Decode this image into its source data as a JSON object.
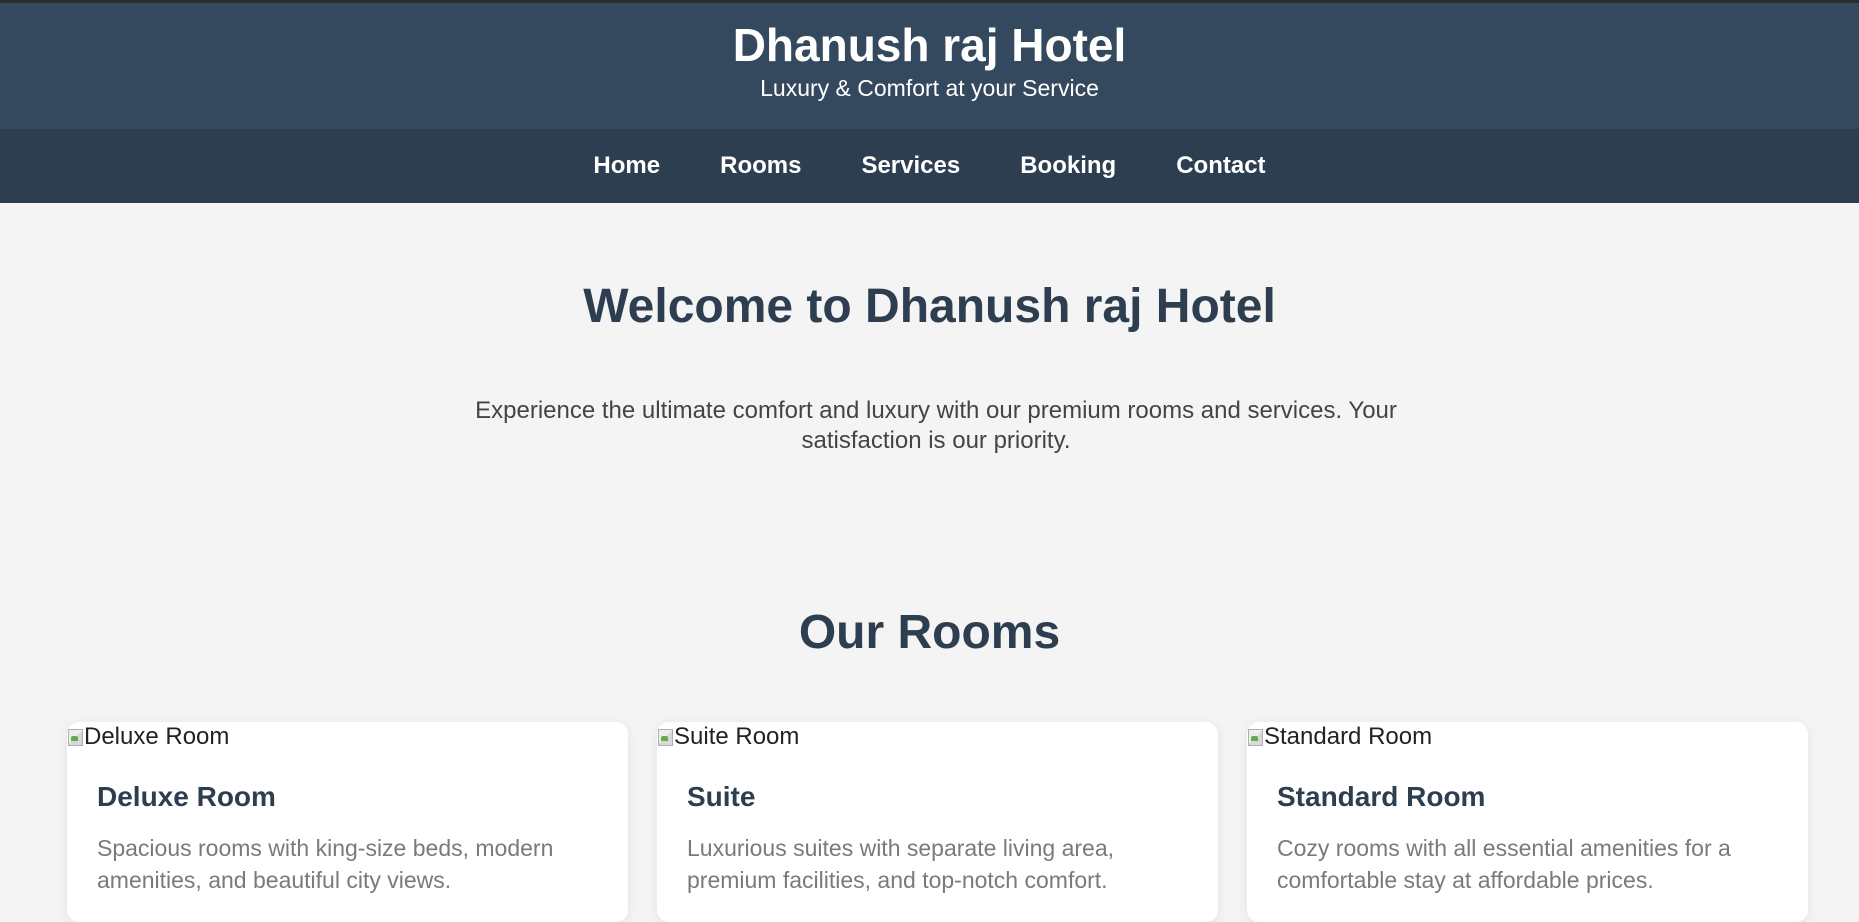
{
  "header": {
    "title": "Dhanush raj Hotel",
    "tagline": "Luxury & Comfort at your Service"
  },
  "nav": {
    "items": [
      {
        "label": "Home"
      },
      {
        "label": "Rooms"
      },
      {
        "label": "Services"
      },
      {
        "label": "Booking"
      },
      {
        "label": "Contact"
      }
    ]
  },
  "welcome": {
    "title": "Welcome to Dhanush raj Hotel",
    "text": "Experience the ultimate comfort and luxury with our premium rooms and services. Your satisfaction is our priority."
  },
  "rooms": {
    "title": "Our Rooms",
    "cards": [
      {
        "image_alt": "Deluxe Room",
        "name": "Deluxe Room",
        "description": "Spacious rooms with king-size beds, modern amenities, and beautiful city views."
      },
      {
        "image_alt": "Suite Room",
        "name": "Suite",
        "description": "Luxurious suites with separate living area, premium facilities, and top-notch comfort."
      },
      {
        "image_alt": "Standard Room",
        "name": "Standard Room",
        "description": "Cozy rooms with all essential amenities for a comfortable stay at affordable prices."
      }
    ]
  },
  "colors": {
    "header_bg": "#34495e",
    "nav_bg": "#2c3e50",
    "page_bg": "#f4f4f4",
    "heading": "#2c3e50"
  }
}
